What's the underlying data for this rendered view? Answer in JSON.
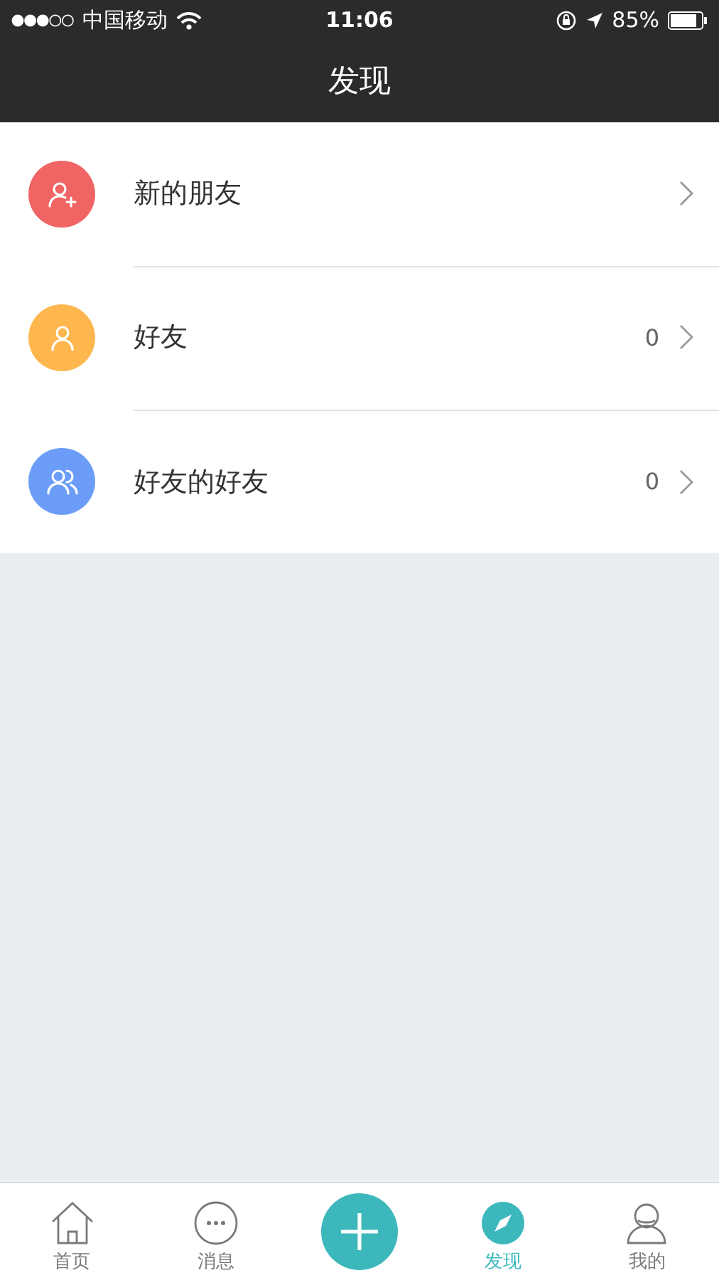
{
  "status_bar": {
    "carrier": "中国移动",
    "time": "11:06",
    "battery": "85%"
  },
  "nav": {
    "title": "发现"
  },
  "rows": [
    {
      "kind": "addperson",
      "color": "#f06464",
      "label": "新的朋友"
    },
    {
      "kind": "person",
      "color": "#fdb74e",
      "label": "好友",
      "count": "0"
    },
    {
      "kind": "people",
      "color": "#6a9cf8",
      "label": "好友的好友",
      "count": "0"
    }
  ],
  "tabs": [
    {
      "kind": "home",
      "label": "首页",
      "selected": false
    },
    {
      "kind": "chat",
      "label": "消息",
      "selected": false
    },
    {
      "kind": "add"
    },
    {
      "kind": "compass",
      "label": "发现",
      "selected": true
    },
    {
      "kind": "profile",
      "label": "我的",
      "selected": false
    }
  ]
}
